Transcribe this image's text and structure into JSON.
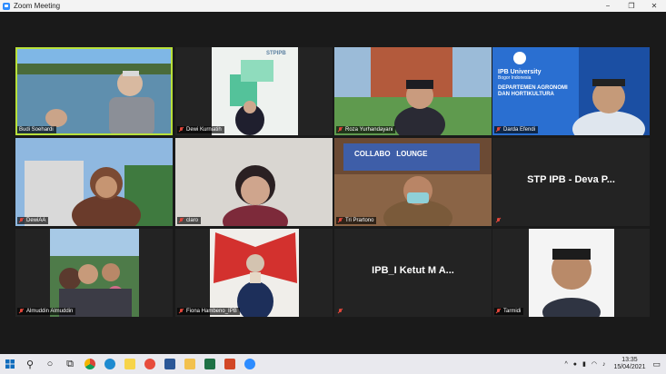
{
  "window": {
    "title": "Zoom Meeting",
    "minimize": "−",
    "maximize": "❐",
    "close": "✕"
  },
  "participants": [
    {
      "name": "Budi Soehardi",
      "muted": false,
      "active": true
    },
    {
      "name": "Dewi Kurniatih",
      "muted": true
    },
    {
      "name": "Roza Yurhandayani",
      "muted": true
    },
    {
      "name": "Darda Efendi",
      "muted": true
    },
    {
      "name": "DewiAA",
      "muted": true
    },
    {
      "name": "claro",
      "muted": true
    },
    {
      "name": "Tri Prartono",
      "muted": true
    },
    {
      "name": "",
      "muted": true,
      "display_name": "STP IPB - Deva P..."
    },
    {
      "name": "Almuddin Almuddin",
      "muted": true
    },
    {
      "name": "Fiona Hambeno_IPB",
      "muted": true
    },
    {
      "name": "",
      "muted": true,
      "display_name": "IPB_I Ketut M A..."
    },
    {
      "name": "Tarmidi",
      "muted": true
    }
  ],
  "backgrounds": {
    "stp_logo": "STPIPB",
    "ipb_title": "IPB University",
    "ipb_sub": "Bogor Indonesia",
    "ipb_dept1": "DEPARTEMEN AGRONOMI",
    "ipb_dept2": "DAN HORTIKULTURA",
    "collab_sign": "COLLABO   LOUNGE"
  },
  "taskbar": {
    "time": "13:35",
    "date": "15/04/2021",
    "icons": [
      "windows-start",
      "search",
      "cortana",
      "task-view",
      "chrome",
      "edge",
      "sticky-notes",
      "app-red",
      "word",
      "file-explorer",
      "excel",
      "powerpoint",
      "zoom"
    ]
  },
  "colors": {
    "active_border": "#b8e03a",
    "muted_icon": "#e0463b",
    "zoom_blue": "#2d8cff"
  }
}
